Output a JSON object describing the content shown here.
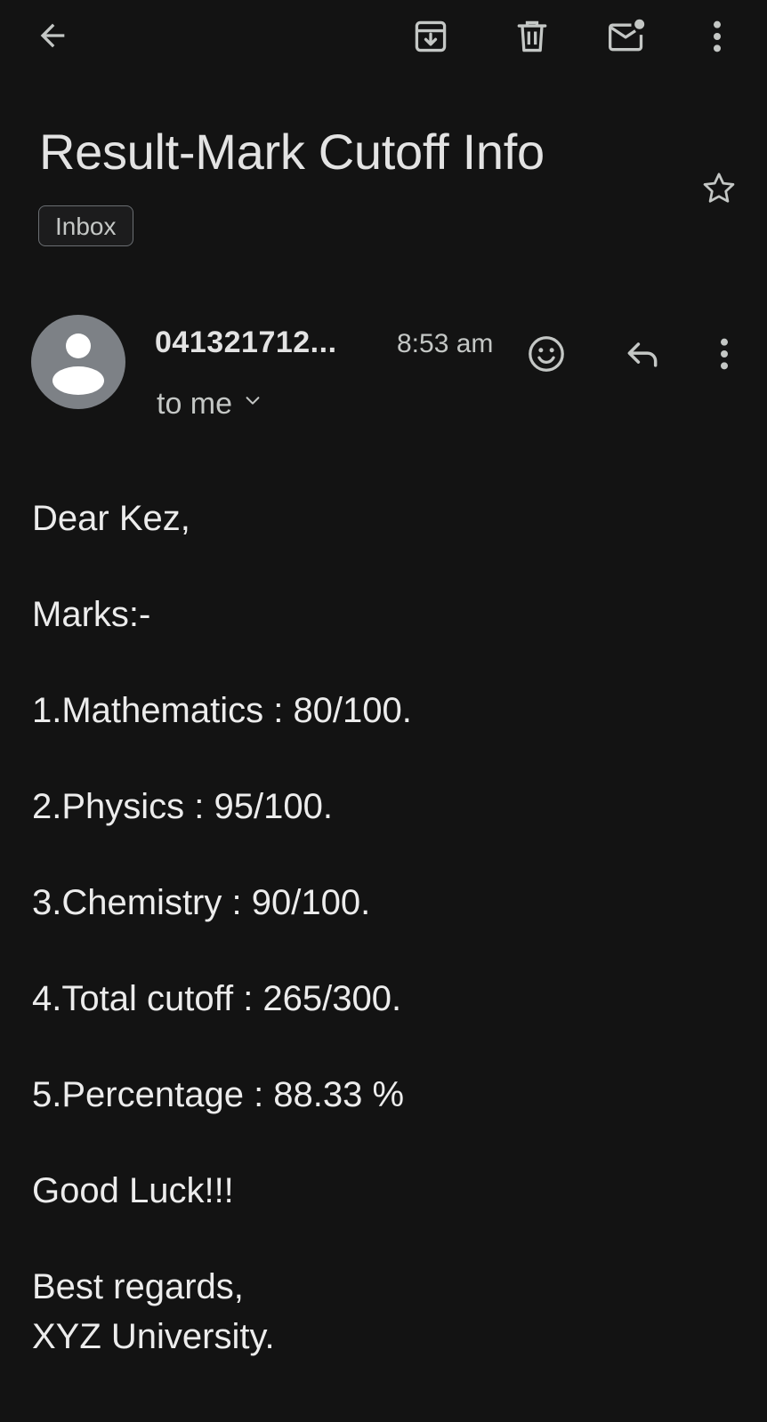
{
  "toolbar": {
    "back": "back-arrow-icon",
    "archive": "archive-icon",
    "delete": "trash-icon",
    "mark_unread": "mark-unread-icon",
    "more": "more-vert-icon"
  },
  "email": {
    "subject": "Result-Mark Cutoff Info",
    "label": "Inbox",
    "sender": "041321712...",
    "time": "8:53 am",
    "recipient": "to me",
    "body": {
      "greeting": "Dear Kez,",
      "marks_heading": "Marks:-",
      "lines": [
        "1.Mathematics : 80/100.",
        "2.Physics : 95/100.",
        "3.Chemistry : 90/100.",
        "4.Total cutoff : 265/300.",
        "5.Percentage : 88.33 %"
      ],
      "closing": "Good Luck!!!",
      "signoff": "Best regards,",
      "signature": "XYZ University."
    }
  },
  "colors": {
    "background": "#131313",
    "text_primary": "#e3e3e3",
    "text_secondary": "#c4c7c5",
    "avatar_bg": "#7d8186"
  }
}
